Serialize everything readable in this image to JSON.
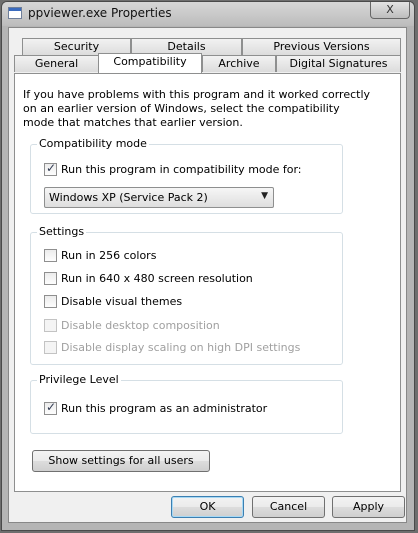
{
  "window": {
    "title": "ppviewer.exe Properties",
    "close_label": "X"
  },
  "tabs": {
    "row_back": [
      {
        "label": "Security"
      },
      {
        "label": "Details"
      },
      {
        "label": "Previous Versions"
      }
    ],
    "row_front": [
      {
        "label": "General"
      },
      {
        "label": "Compatibility",
        "active": true
      },
      {
        "label": "Archive"
      },
      {
        "label": "Digital Signatures"
      }
    ]
  },
  "compatibility": {
    "intro": "If you have problems with this program and it worked correctly on an earlier version of Windows, select the compatibility mode that matches that earlier version.",
    "mode_group": {
      "label": "Compatibility mode",
      "checkbox_label": "Run this program in compatibility mode for:",
      "checked": true,
      "selected_os": "Windows XP (Service Pack 2)"
    },
    "settings_group": {
      "label": "Settings",
      "options": [
        {
          "label": "Run in 256 colors",
          "checked": false,
          "enabled": true
        },
        {
          "label": "Run in 640 x 480 screen resolution",
          "checked": false,
          "enabled": true
        },
        {
          "label": "Disable visual themes",
          "checked": false,
          "enabled": true
        },
        {
          "label": "Disable desktop composition",
          "checked": false,
          "enabled": false
        },
        {
          "label": "Disable display scaling on high DPI settings",
          "checked": false,
          "enabled": false
        }
      ]
    },
    "privilege_group": {
      "label": "Privilege Level",
      "checkbox_label": "Run this program as an administrator",
      "checked": true
    },
    "show_all_button": "Show settings for all users"
  },
  "footer": {
    "ok": "OK",
    "cancel": "Cancel",
    "apply": "Apply"
  }
}
